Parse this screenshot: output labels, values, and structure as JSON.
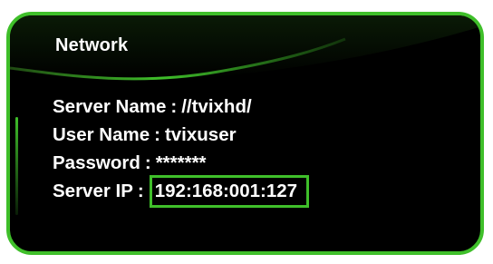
{
  "panel": {
    "title": "Network",
    "accent_color": "#3fbf2a",
    "background_color": "#000000"
  },
  "fields": [
    {
      "label": "Server Name",
      "separator": ":",
      "value": "//tvixhd/"
    },
    {
      "label": "User Name",
      "separator": ":",
      "value": "tvixuser"
    },
    {
      "label": "Password",
      "separator": ":",
      "value": "*******"
    },
    {
      "label": "Server IP",
      "separator": ":",
      "value": "192:168:001:127"
    }
  ]
}
